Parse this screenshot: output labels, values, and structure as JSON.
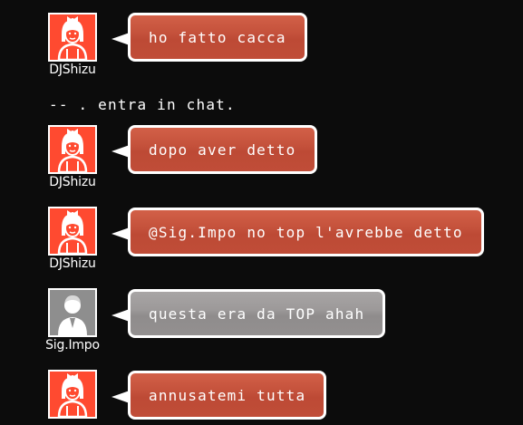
{
  "messages": [
    {
      "user": "DJShizu",
      "text": "ho fatto cacca",
      "avatar": "female-user-icon",
      "color": "#c4513b"
    },
    {
      "user": "DJShizu",
      "text": "dopo aver detto",
      "avatar": "female-user-icon",
      "color": "#c4513b"
    },
    {
      "user": "DJShizu",
      "text": "@Sig.Impo no top l'avrebbe detto",
      "avatar": "female-user-icon",
      "color": "#c4513b"
    },
    {
      "user": "Sig.Impo",
      "text": "questa era da TOP ahah",
      "avatar": "male-user-icon",
      "color": "#9c9999"
    },
    {
      "user": "",
      "text": "annusatemi tutta",
      "avatar": "female-user-icon",
      "color": "#c4513b"
    }
  ],
  "system_message": "-- . entra in chat."
}
